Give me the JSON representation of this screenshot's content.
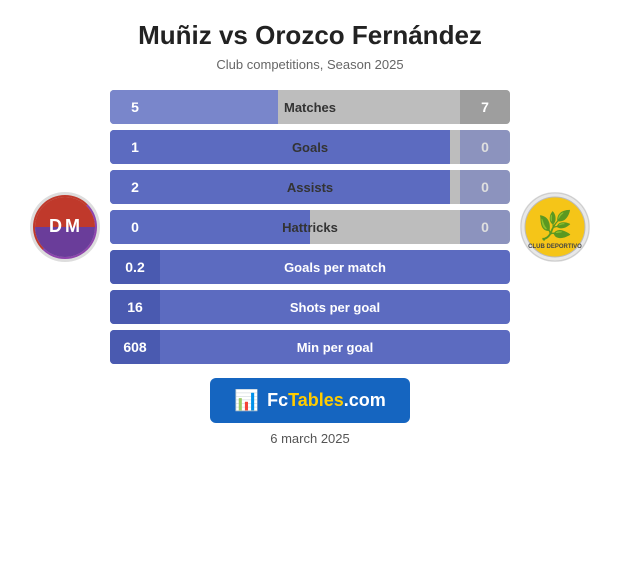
{
  "header": {
    "title": "Muñiz vs Orozco Fernández",
    "subtitle": "Club competitions, Season 2025"
  },
  "stats": [
    {
      "label": "Matches",
      "left_val": "5",
      "right_val": "7",
      "type": "two-sided",
      "left_pct": 42
    },
    {
      "label": "Goals",
      "left_val": "1",
      "right_val": "0",
      "type": "two-sided",
      "left_pct": 80
    },
    {
      "label": "Assists",
      "left_val": "2",
      "right_val": "0",
      "type": "two-sided",
      "left_pct": 80
    },
    {
      "label": "Hattricks",
      "left_val": "0",
      "right_val": "0",
      "type": "two-sided",
      "left_pct": 50
    },
    {
      "label": "Goals per match",
      "left_val": "0.2",
      "right_val": null,
      "type": "full"
    },
    {
      "label": "Shots per goal",
      "left_val": "16",
      "right_val": null,
      "type": "full"
    },
    {
      "label": "Min per goal",
      "left_val": "608",
      "right_val": null,
      "type": "full"
    }
  ],
  "watermark": {
    "icon": "📊",
    "text_plain": "Fc",
    "text_highlight": "Tables",
    "text_end": ".com"
  },
  "date": "6 march 2025",
  "logos": {
    "left": {
      "initials": "DM",
      "alt": "Deportivo Independiente Medellín"
    },
    "right": {
      "alt": "La Equidad"
    }
  }
}
